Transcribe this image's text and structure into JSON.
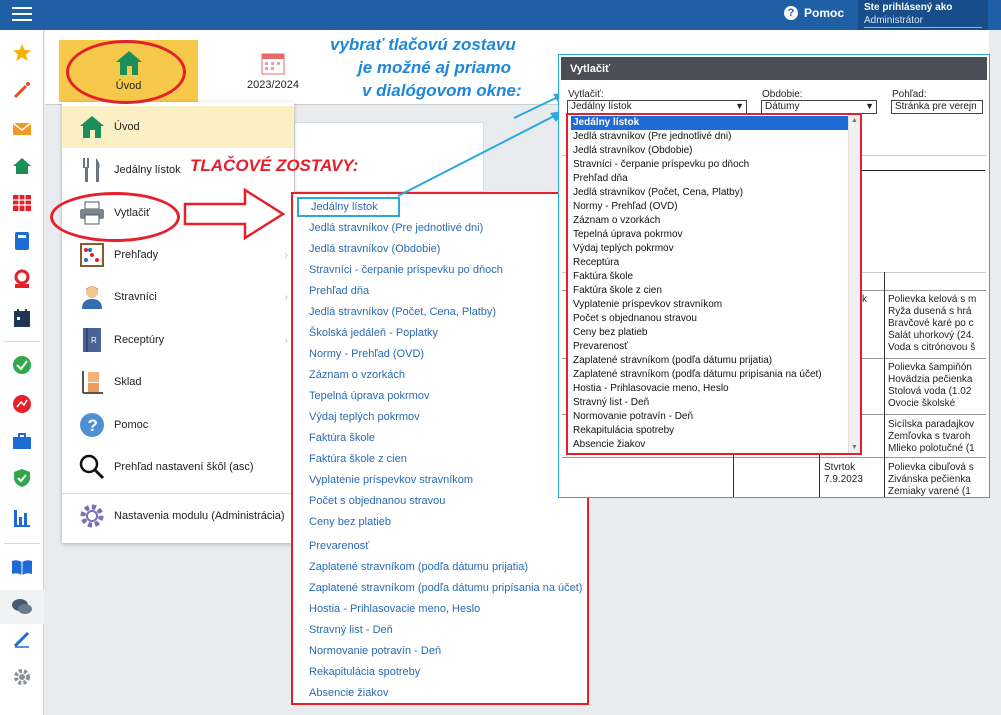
{
  "topbar": {
    "help_label": "Pomoc",
    "help_icon": "?",
    "user_title": "Ste prihlásený ako",
    "user_role": "Administrátor"
  },
  "tiles": {
    "home_label": "Úvod",
    "year_label": "2023/2024"
  },
  "menu": {
    "items": [
      {
        "label": "Úvod",
        "icon": "home-icon"
      },
      {
        "label": "Jedálny lístok",
        "icon": "cutlery-icon"
      },
      {
        "label": "Vytlačiť",
        "icon": "printer-icon"
      },
      {
        "label": "Prehľady",
        "icon": "abacus-icon"
      },
      {
        "label": "Stravníci",
        "icon": "person-icon"
      },
      {
        "label": "Receptúry",
        "icon": "book-icon"
      },
      {
        "label": "Sklad",
        "icon": "boxes-icon"
      },
      {
        "label": "Pomoc",
        "icon": "question-icon"
      },
      {
        "label": "Prehľad nastavení škôl (asc)",
        "icon": "magnifier-icon"
      },
      {
        "label": "Nastavenia modulu (Administrácia)",
        "icon": "gear-icon"
      }
    ]
  },
  "annotations": {
    "tlacove": "TLAČOVÉ ZOSTAVY:",
    "line1": "vybrať tlačovú zostavu",
    "line2": "je možné aj priamo",
    "line3": "v dialógovom okne:"
  },
  "print_list": [
    "Jedálny lístok",
    "Jedlá stravníkov (Pre jednotlivé dni)",
    "Jedlá stravníkov (Obdobie)",
    "Stravníci - čerpanie príspevku po dňoch",
    "Prehľad dňa",
    "Jedlá stravníkov (Počet, Cena, Platby)",
    "Školská jedáleň - Poplatky",
    "Normy - Prehľad (OVD)",
    "Záznam o vzorkách",
    "Tepelná úprava pokrmov",
    "Výdaj teplých pokrmov",
    "Faktúra škole",
    "Faktúra škole z cien",
    "Vyplatenie príspevkov stravníkom",
    "Počet s objednanou stravou",
    "Ceny bez platieb",
    "Prevarenosť",
    "Zaplatené stravníkom (podľa dátumu prijatia)",
    "Zaplatené stravníkom (podľa dátumu pripísania na účet)",
    "Hostia - Prihlasovacie meno, Heslo",
    "Stravný list - Deň",
    "Normovanie potravín - Deň",
    "Rekapitulácia spotreby",
    "Absencie žiakov"
  ],
  "dialog": {
    "title": "Vytlačiť",
    "vytlacit_label": "Vytlačiť:",
    "vytlacit_value": "Jedálny lístok",
    "obdobie_label": "Obdobie:",
    "obdobie_value": "Dátumy",
    "pohlad_label": "Pohľad:",
    "pohlad_value": "Stránka pre verejn",
    "options": [
      "Jedálny lístok",
      "Jedlá stravníkov (Pre jednotlivé dni)",
      "Jedlá stravníkov (Obdobie)",
      "Stravníci - čerpanie príspevku po dňoch",
      "Prehľad dňa",
      "Jedlá stravníkov (Počet, Cena, Platby)",
      "Normy - Prehľad (OVD)",
      "Záznam o vzorkách",
      "Tepelná úprava pokrmov",
      "Výdaj teplých pokrmov",
      "Receptúra",
      "Faktúra škole",
      "Faktúra škole z cien",
      "Vyplatenie príspevkov stravníkom",
      "Počet s objednanou stravou",
      "Ceny bez platieb",
      "Prevarenosť",
      "Zaplatené stravníkom (podľa dátumu prijatia)",
      "Zaplatené stravníkom (podľa dátumu pripísania na účet)",
      "Hostia - Prihlasovacie meno, Heslo",
      "Stravný list - Deň",
      "Normovanie potravín - Deň",
      "Rekapitulácia spotreby",
      "Absencie žiakov"
    ]
  },
  "menu_table": {
    "row1": {
      "day": "k",
      "dishes": [
        "Polievka kelová s m",
        "Ryža dusená s hrá",
        "Bravčové karé po c",
        "Šalát uhorkový (24.",
        "Voda s citrónovou š"
      ]
    },
    "row2": {
      "dishes": [
        "Polievka šampiňón",
        "Hovädzia pečienka",
        "Stolová voda (1.02",
        "Ovocie školské"
      ]
    },
    "row3": {
      "dishes": [
        "Sicílska paradajkov",
        "Žemľovka s tvaroh",
        "Mlieko polotučné (1"
      ]
    },
    "row4": {
      "day": "Štvrtok",
      "date": "7.9.2023",
      "dishes": [
        "Polievka cibuľová s",
        "Živánska pečienka",
        "Zemiaky varené (1"
      ]
    }
  }
}
